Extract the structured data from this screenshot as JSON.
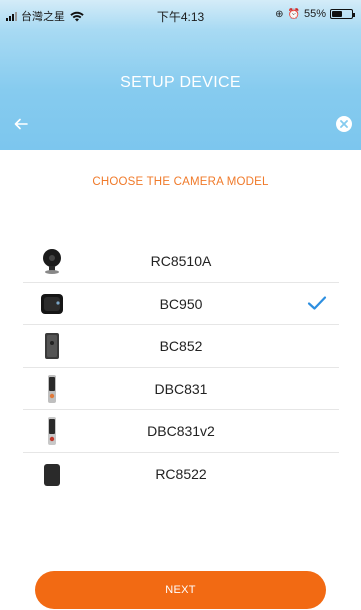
{
  "status_bar": {
    "carrier": "台灣之星",
    "time": "下午4:13",
    "battery": "55%",
    "battery_level": 0.55,
    "icons": [
      "signal-icon",
      "wifi-icon",
      "alarm-icon",
      "orientation-lock-icon",
      "battery-icon"
    ]
  },
  "header": {
    "title": "SETUP DEVICE",
    "background_color": "#7cc6ee"
  },
  "main": {
    "subtitle": "CHOOSE THE CAMERA MODEL",
    "accent_color": "#f26a13",
    "models": [
      {
        "label": "RC8510A",
        "selected": false,
        "icon": "round-camera-icon"
      },
      {
        "label": "BC950",
        "selected": true,
        "icon": "battery-camera-icon"
      },
      {
        "label": "BC852",
        "selected": false,
        "icon": "battery-camera-icon"
      },
      {
        "label": "DBC831",
        "selected": false,
        "icon": "doorbell-camera-icon"
      },
      {
        "label": "DBC831v2",
        "selected": false,
        "icon": "doorbell-camera-icon"
      },
      {
        "label": "RC8522",
        "selected": false,
        "icon": "camera-icon"
      }
    ]
  },
  "footer": {
    "next_label": "NEXT"
  }
}
